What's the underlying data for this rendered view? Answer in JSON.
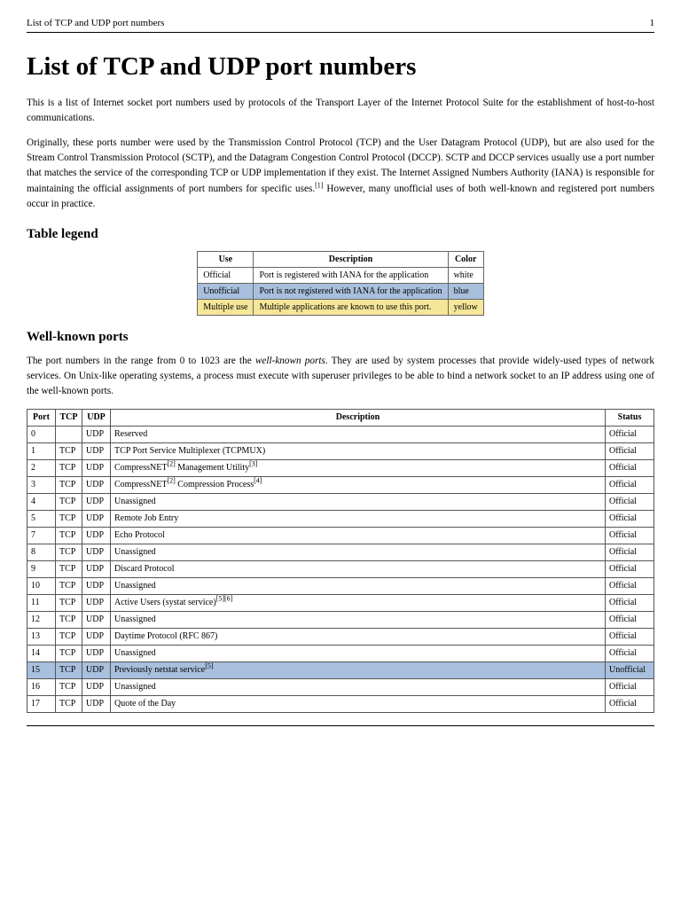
{
  "header": {
    "running_title": "List of TCP and UDP port numbers",
    "page_number": "1"
  },
  "title": "List of TCP and UDP port numbers",
  "intro": {
    "p1": "This is a list of Internet socket port numbers used by protocols of the Transport Layer of the Internet Protocol Suite for the establishment of host-to-host communications.",
    "p2a": "Originally, these ports number were used by the Transmission Control Protocol (TCP) and the User Datagram Protocol (UDP), but are also used for the Stream Control Transmission Protocol (SCTP), and the Datagram Congestion Control Protocol (DCCP). SCTP and DCCP services usually use a port number that matches the service of the corresponding TCP or UDP implementation if they exist. The Internet Assigned Numbers Authority (IANA) is responsible for maintaining the official assignments of port numbers for specific uses.",
    "p2_ref": "[1]",
    "p2b": " However, many unofficial uses of both well-known and registered port numbers occur in practice."
  },
  "legend": {
    "heading": "Table legend",
    "cols": {
      "use": "Use",
      "desc": "Description",
      "color": "Color"
    },
    "rows": [
      {
        "use": "Official",
        "desc": "Port is registered with IANA for the application",
        "color": "white",
        "class": "bg-white"
      },
      {
        "use": "Unofficial",
        "desc": "Port is not registered with IANA for the application",
        "color": "blue",
        "class": "bg-blue"
      },
      {
        "use": "Multiple use",
        "desc": "Multiple applications are known to use this port.",
        "color": "yellow",
        "class": "bg-yellow"
      }
    ]
  },
  "wellknown": {
    "heading": "Well-known ports",
    "para_a": "The port numbers in the range from 0 to 1023 are the ",
    "para_em": "well-known ports",
    "para_b": ". They are used by system processes that provide widely-used types of network services. On Unix-like operating systems, a process must execute with superuser privileges to be able to bind a network socket to an IP address using one of the well-known ports."
  },
  "ports_table": {
    "cols": {
      "port": "Port",
      "tcp": "TCP",
      "udp": "UDP",
      "desc": "Description",
      "status": "Status"
    },
    "rows": [
      {
        "port": "0",
        "tcp": "",
        "udp": "UDP",
        "desc": "Reserved",
        "status": "Official",
        "row_class": ""
      },
      {
        "port": "1",
        "tcp": "TCP",
        "udp": "UDP",
        "desc": "TCP Port Service Multiplexer (TCPMUX)",
        "status": "Official",
        "row_class": ""
      },
      {
        "port": "2",
        "tcp": "TCP",
        "udp": "UDP",
        "desc_parts": [
          "CompressNET",
          "[2]",
          " Management Utility",
          "[3]"
        ],
        "status": "Official",
        "row_class": ""
      },
      {
        "port": "3",
        "tcp": "TCP",
        "udp": "UDP",
        "desc_parts": [
          "CompressNET",
          "[2]",
          " Compression Process",
          "[4]"
        ],
        "status": "Official",
        "row_class": ""
      },
      {
        "port": "4",
        "tcp": "TCP",
        "udp": "UDP",
        "desc": "Unassigned",
        "status": "Official",
        "row_class": ""
      },
      {
        "port": "5",
        "tcp": "TCP",
        "udp": "UDP",
        "desc": "Remote Job Entry",
        "status": "Official",
        "row_class": ""
      },
      {
        "port": "7",
        "tcp": "TCP",
        "udp": "UDP",
        "desc": "Echo Protocol",
        "status": "Official",
        "row_class": ""
      },
      {
        "port": "8",
        "tcp": "TCP",
        "udp": "UDP",
        "desc": "Unassigned",
        "status": "Official",
        "row_class": ""
      },
      {
        "port": "9",
        "tcp": "TCP",
        "udp": "UDP",
        "desc": "Discard Protocol",
        "status": "Official",
        "row_class": ""
      },
      {
        "port": "10",
        "tcp": "TCP",
        "udp": "UDP",
        "desc": "Unassigned",
        "status": "Official",
        "row_class": ""
      },
      {
        "port": "11",
        "tcp": "TCP",
        "udp": "UDP",
        "desc_parts": [
          "Active Users (systat service)",
          "[5][6]"
        ],
        "status": "Official",
        "row_class": ""
      },
      {
        "port": "12",
        "tcp": "TCP",
        "udp": "UDP",
        "desc": "Unassigned",
        "status": "Official",
        "row_class": ""
      },
      {
        "port": "13",
        "tcp": "TCP",
        "udp": "UDP",
        "desc": "Daytime Protocol (RFC 867)",
        "status": "Official",
        "row_class": ""
      },
      {
        "port": "14",
        "tcp": "TCP",
        "udp": "UDP",
        "desc": "Unassigned",
        "status": "Official",
        "row_class": ""
      },
      {
        "port": "15",
        "tcp": "TCP",
        "udp": "UDP",
        "desc_parts": [
          "Previously netstat service",
          "[5]"
        ],
        "status": "Unofficial",
        "row_class": "row-unofficial"
      },
      {
        "port": "16",
        "tcp": "TCP",
        "udp": "UDP",
        "desc": "Unassigned",
        "status": "Official",
        "row_class": ""
      },
      {
        "port": "17",
        "tcp": "TCP",
        "udp": "UDP",
        "desc": "Quote of the Day",
        "status": "Official",
        "row_class": ""
      }
    ]
  }
}
